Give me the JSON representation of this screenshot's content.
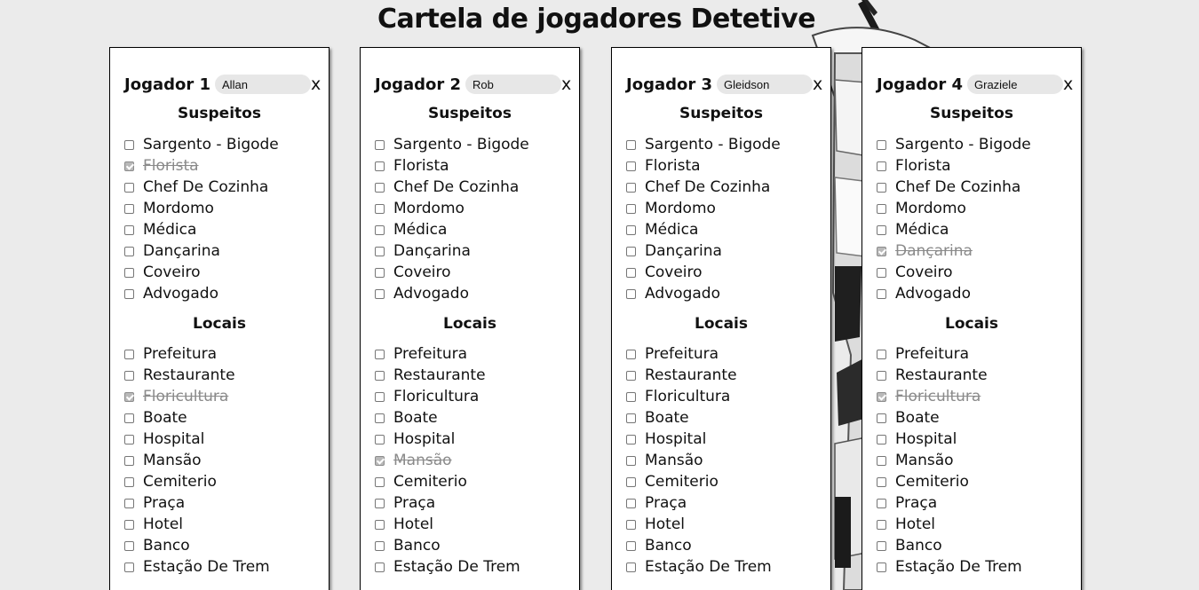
{
  "page": {
    "title": "Cartela de jogadores Detetive"
  },
  "section_titles": {
    "suspects": "Suspeitos",
    "locations": "Locais"
  },
  "close_label": "x",
  "players": [
    {
      "label": "Jogador 1",
      "name": "Allan",
      "suspects": [
        {
          "label": "Sargento - Bigode",
          "checked": false
        },
        {
          "label": "Florista",
          "checked": true
        },
        {
          "label": "Chef De Cozinha",
          "checked": false
        },
        {
          "label": "Mordomo",
          "checked": false
        },
        {
          "label": "Médica",
          "checked": false
        },
        {
          "label": "Dançarina",
          "checked": false
        },
        {
          "label": "Coveiro",
          "checked": false
        },
        {
          "label": "Advogado",
          "checked": false
        }
      ],
      "locations": [
        {
          "label": "Prefeitura",
          "checked": false
        },
        {
          "label": "Restaurante",
          "checked": false
        },
        {
          "label": "Floricultura",
          "checked": true
        },
        {
          "label": "Boate",
          "checked": false
        },
        {
          "label": "Hospital",
          "checked": false
        },
        {
          "label": "Mansão",
          "checked": false
        },
        {
          "label": "Cemiterio",
          "checked": false
        },
        {
          "label": "Praça",
          "checked": false
        },
        {
          "label": "Hotel",
          "checked": false
        },
        {
          "label": "Banco",
          "checked": false
        },
        {
          "label": "Estação De Trem",
          "checked": false
        }
      ]
    },
    {
      "label": "Jogador 2",
      "name": "Rob",
      "suspects": [
        {
          "label": "Sargento - Bigode",
          "checked": false
        },
        {
          "label": "Florista",
          "checked": false
        },
        {
          "label": "Chef De Cozinha",
          "checked": false
        },
        {
          "label": "Mordomo",
          "checked": false
        },
        {
          "label": "Médica",
          "checked": false
        },
        {
          "label": "Dançarina",
          "checked": false
        },
        {
          "label": "Coveiro",
          "checked": false
        },
        {
          "label": "Advogado",
          "checked": false
        }
      ],
      "locations": [
        {
          "label": "Prefeitura",
          "checked": false
        },
        {
          "label": "Restaurante",
          "checked": false
        },
        {
          "label": "Floricultura",
          "checked": false
        },
        {
          "label": "Boate",
          "checked": false
        },
        {
          "label": "Hospital",
          "checked": false
        },
        {
          "label": "Mansão",
          "checked": true
        },
        {
          "label": "Cemiterio",
          "checked": false
        },
        {
          "label": "Praça",
          "checked": false
        },
        {
          "label": "Hotel",
          "checked": false
        },
        {
          "label": "Banco",
          "checked": false
        },
        {
          "label": "Estação De Trem",
          "checked": false
        }
      ]
    },
    {
      "label": "Jogador 3",
      "name": "Gleidson",
      "suspects": [
        {
          "label": "Sargento - Bigode",
          "checked": false
        },
        {
          "label": "Florista",
          "checked": false
        },
        {
          "label": "Chef De Cozinha",
          "checked": false
        },
        {
          "label": "Mordomo",
          "checked": false
        },
        {
          "label": "Médica",
          "checked": false
        },
        {
          "label": "Dançarina",
          "checked": false
        },
        {
          "label": "Coveiro",
          "checked": false
        },
        {
          "label": "Advogado",
          "checked": false
        }
      ],
      "locations": [
        {
          "label": "Prefeitura",
          "checked": false
        },
        {
          "label": "Restaurante",
          "checked": false
        },
        {
          "label": "Floricultura",
          "checked": false
        },
        {
          "label": "Boate",
          "checked": false
        },
        {
          "label": "Hospital",
          "checked": false
        },
        {
          "label": "Mansão",
          "checked": false
        },
        {
          "label": "Cemiterio",
          "checked": false
        },
        {
          "label": "Praça",
          "checked": false
        },
        {
          "label": "Hotel",
          "checked": false
        },
        {
          "label": "Banco",
          "checked": false
        },
        {
          "label": "Estação De Trem",
          "checked": false
        }
      ]
    },
    {
      "label": "Jogador 4",
      "name": "Graziele",
      "suspects": [
        {
          "label": "Sargento - Bigode",
          "checked": false
        },
        {
          "label": "Florista",
          "checked": false
        },
        {
          "label": "Chef De Cozinha",
          "checked": false
        },
        {
          "label": "Mordomo",
          "checked": false
        },
        {
          "label": "Médica",
          "checked": false
        },
        {
          "label": "Dançarina",
          "checked": true
        },
        {
          "label": "Coveiro",
          "checked": false
        },
        {
          "label": "Advogado",
          "checked": false
        }
      ],
      "locations": [
        {
          "label": "Prefeitura",
          "checked": false
        },
        {
          "label": "Restaurante",
          "checked": false
        },
        {
          "label": "Floricultura",
          "checked": true
        },
        {
          "label": "Boate",
          "checked": false
        },
        {
          "label": "Hospital",
          "checked": false
        },
        {
          "label": "Mansão",
          "checked": false
        },
        {
          "label": "Cemiterio",
          "checked": false
        },
        {
          "label": "Praça",
          "checked": false
        },
        {
          "label": "Hotel",
          "checked": false
        },
        {
          "label": "Banco",
          "checked": false
        },
        {
          "label": "Estação De Trem",
          "checked": false
        }
      ]
    }
  ]
}
